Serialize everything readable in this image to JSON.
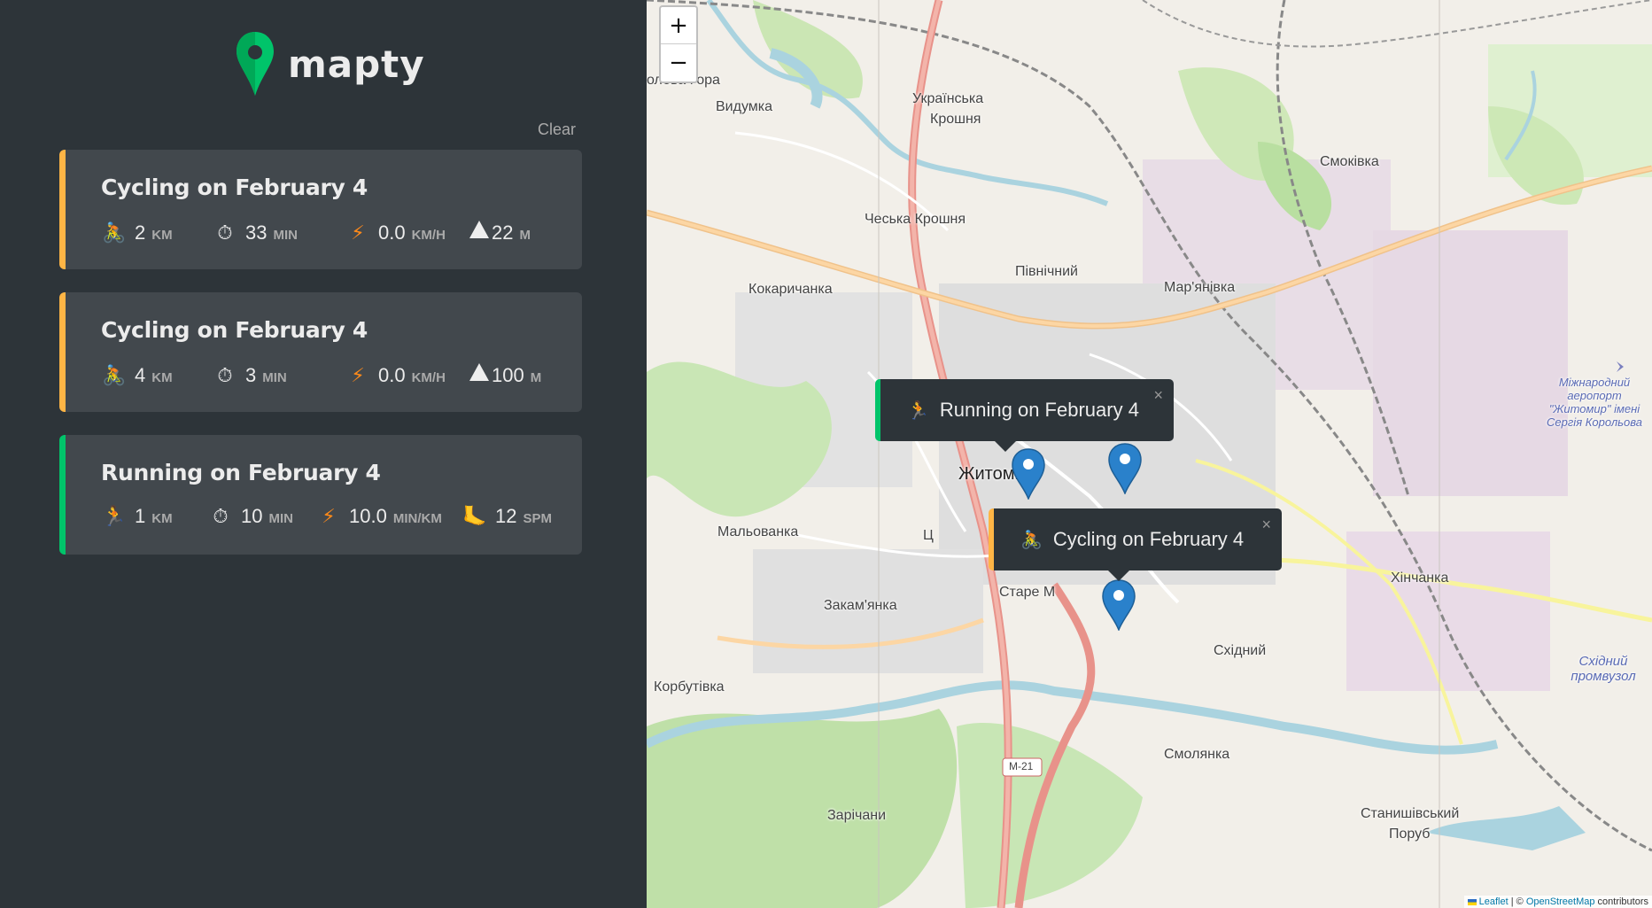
{
  "app": {
    "name": "mapty"
  },
  "sidebar": {
    "clear_label": "Clear",
    "workouts": [
      {
        "type": "cycling",
        "title": "Cycling on February 4",
        "icon": "🚴",
        "distance": "2",
        "distance_unit": "km",
        "duration": "33",
        "duration_unit": "min",
        "speed": "0.0",
        "speed_unit": "km/h",
        "elevation": "22",
        "elevation_unit": "m"
      },
      {
        "type": "cycling",
        "title": "Cycling on February 4",
        "icon": "🚴",
        "distance": "4",
        "distance_unit": "km",
        "duration": "3",
        "duration_unit": "min",
        "speed": "0.0",
        "speed_unit": "km/h",
        "elevation": "100",
        "elevation_unit": "m"
      },
      {
        "type": "running",
        "title": "Running on February 4",
        "icon": "🏃",
        "distance": "1",
        "distance_unit": "km",
        "duration": "10",
        "duration_unit": "min",
        "pace": "10.0",
        "pace_unit": "min/km",
        "cadence": "12",
        "cadence_unit": "spm"
      }
    ]
  },
  "map": {
    "zoom_in": "+",
    "zoom_out": "−",
    "popups": [
      {
        "type": "running",
        "icon": "🏃",
        "text": "Running on February 4",
        "close": "×"
      },
      {
        "type": "cycling",
        "icon": "🚴",
        "text": "Cycling on February 4",
        "close": "×"
      }
    ],
    "places": {
      "p1": "Видумка",
      "p2": "Українська",
      "p3": "Крошня",
      "p4": "Смоківка",
      "p5": "Чеська Крошня",
      "p6": "Північний",
      "p7": "Мар'янівка",
      "p8": "Кокаричанка",
      "p9": "Житомир",
      "p10": "Мальованка",
      "p11": "Закам'янка",
      "p12": "Старе М",
      "p13": "Хінчанка",
      "p14": "Корбутівка",
      "p15": "Східний",
      "p16": "Смолянка",
      "p17": "Зарічани",
      "p18": "Станишівський",
      "p19": "Поруб",
      "p20": "Східний промвузол",
      "p21": "Міжнародний аеропорт \"Житомир\" імені Сергія Корольова",
      "p22": "олова Гора",
      "p23": "Ц",
      "p24": "М-21"
    },
    "attribution": {
      "leaflet": "Leaflet",
      "sep": " | © ",
      "osm": "OpenStreetMap",
      "tail": " contributors"
    }
  },
  "colors": {
    "cycling": "#ffb545",
    "running": "#00c46a",
    "sidebar": "#2d3439",
    "card": "#42484d",
    "marker": "#2a81cb"
  }
}
